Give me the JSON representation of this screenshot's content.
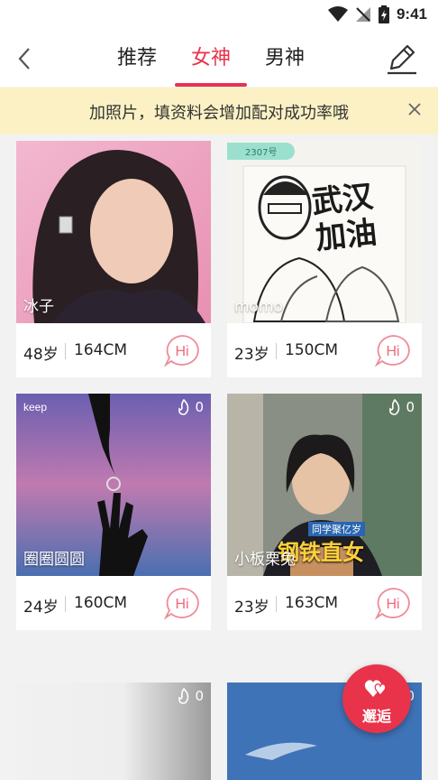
{
  "status_bar": {
    "time": "9:41"
  },
  "header": {
    "tabs": [
      {
        "label": "推荐",
        "active": false
      },
      {
        "label": "女神",
        "active": true
      },
      {
        "label": "男神",
        "active": false
      }
    ]
  },
  "banner": {
    "text": "加照片，填资料会增加配对成功率哦"
  },
  "cards": [
    {
      "name": "冰子",
      "age": "48岁",
      "height": "164CM",
      "hi_label": "Hi"
    },
    {
      "name": "momo",
      "age": "23岁",
      "height": "150CM",
      "hi_label": "Hi",
      "tag": "2307号",
      "poster_text": "武汉加油"
    },
    {
      "name": "圈圈圆圆",
      "age": "24岁",
      "height": "160CM",
      "hi_label": "Hi",
      "likes": "0",
      "brand": "keep"
    },
    {
      "name": "小板栗兔",
      "age": "23岁",
      "height": "163CM",
      "hi_label": "Hi",
      "likes": "0",
      "overlay_text": "钢铁直女",
      "overlay_sub": "同学聚亿岁"
    },
    {
      "likes": "0"
    },
    {
      "likes": "0"
    }
  ],
  "fab": {
    "label": "邂逅"
  },
  "colors": {
    "accent": "#e8334a",
    "banner_bg": "#fbf1c4"
  }
}
